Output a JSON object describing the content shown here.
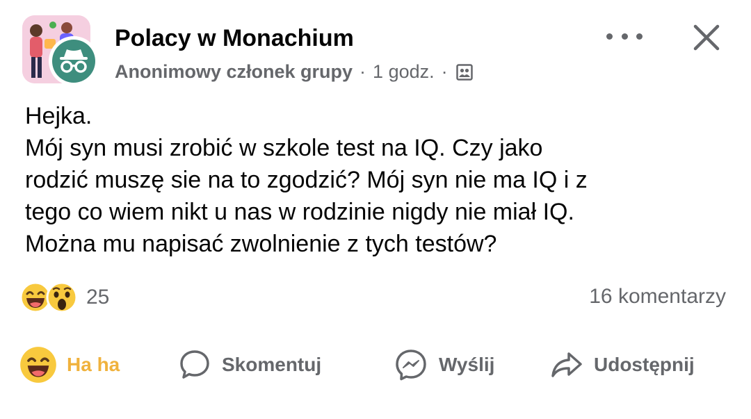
{
  "header": {
    "group_name": "Polacy w Monachium",
    "author": "Anonimowy członek grupy",
    "separator": "·",
    "time": "1 godz.",
    "audience_icon": "group-members-icon"
  },
  "post": {
    "lines": [
      "Hejka.",
      "Mój syn musi zrobić w szkole test na IQ. Czy jako",
      "rodzić muszę sie na to zgodzić? Mój syn nie ma IQ i z",
      "tego co wiem nikt u nas w rodzinie nigdy nie miał IQ.",
      "Można mu napisać zwolnienie z tych testów?"
    ]
  },
  "reactions": {
    "types": [
      "haha-emoji",
      "wow-emoji"
    ],
    "count": "25",
    "comments": "16 komentarzy"
  },
  "actions": {
    "haha": "Ha ha",
    "comment": "Skomentuj",
    "send": "Wyślij",
    "share": "Udostępnij"
  },
  "colors": {
    "haha_label": "#f0b23d",
    "secondary_text": "#65676b",
    "anon_badge": "#3e8e7e"
  }
}
